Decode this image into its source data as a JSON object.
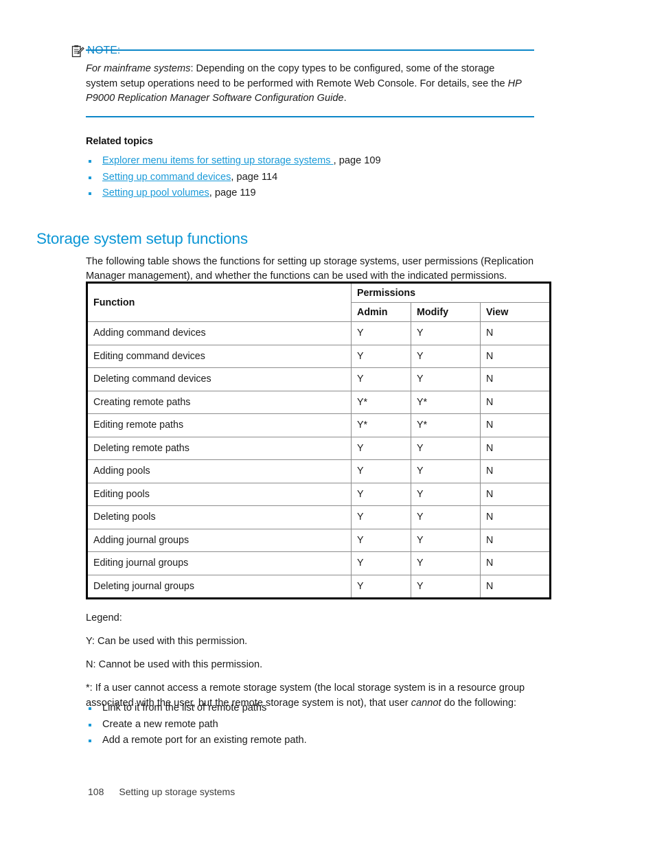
{
  "note": {
    "icon": "note-clipboard-icon",
    "label": "NOTE:",
    "body_italic_lead": "For mainframe systems",
    "body_part1": ": Depending on the copy types to be configured, some of the storage system setup operations need to be performed with Remote Web Console. For details, see the ",
    "body_italic_title": "HP P9000 Replication Manager Software Configuration Guide",
    "body_end": ".",
    "rule_color": "#0b86c8"
  },
  "related": {
    "title": "Related topics",
    "items": [
      {
        "link": "Explorer menu items for setting up storage systems ",
        "suffix": ", page 109"
      },
      {
        "link": "Setting up command devices",
        "suffix": ", page 114"
      },
      {
        "link": "Setting up pool volumes",
        "suffix": ", page 119"
      }
    ]
  },
  "section": {
    "heading": "Storage system setup functions",
    "heading_color": "#0b96d5",
    "intro": "The following table shows the functions for setting up storage systems, user permissions (Replication Manager management), and whether the functions can be used with the indicated permissions."
  },
  "table": {
    "function_header": "Function",
    "permissions_header": "Permissions",
    "sub_headers": [
      "Admin",
      "Modify",
      "View"
    ],
    "rows": [
      {
        "function": "Adding command devices",
        "admin": "Y",
        "modify": "Y",
        "view": "N"
      },
      {
        "function": "Editing command devices",
        "admin": "Y",
        "modify": "Y",
        "view": "N"
      },
      {
        "function": "Deleting command devices",
        "admin": "Y",
        "modify": "Y",
        "view": "N"
      },
      {
        "function": "Creating remote paths",
        "admin": "Y*",
        "modify": "Y*",
        "view": "N"
      },
      {
        "function": "Editing remote paths",
        "admin": "Y*",
        "modify": "Y*",
        "view": "N"
      },
      {
        "function": "Deleting remote paths",
        "admin": "Y",
        "modify": "Y",
        "view": "N"
      },
      {
        "function": "Adding pools",
        "admin": "Y",
        "modify": "Y",
        "view": "N"
      },
      {
        "function": "Editing pools",
        "admin": "Y",
        "modify": "Y",
        "view": "N"
      },
      {
        "function": "Deleting pools",
        "admin": "Y",
        "modify": "Y",
        "view": "N"
      },
      {
        "function": "Adding journal groups",
        "admin": "Y",
        "modify": "Y",
        "view": "N"
      },
      {
        "function": "Editing journal groups",
        "admin": "Y",
        "modify": "Y",
        "view": "N"
      },
      {
        "function": "Deleting journal groups",
        "admin": "Y",
        "modify": "Y",
        "view": "N"
      }
    ]
  },
  "legend": {
    "title": "Legend:",
    "y_line": "Y: Can be used with this permission.",
    "n_line": "N: Cannot be used with this permission.",
    "star_part1": "*: If a user cannot access a remote storage system (the local storage system is in a resource group associated with the user, but the remote storage system is not), that user ",
    "star_italic": "cannot",
    "star_part2": " do the following:",
    "items": [
      "Link to it from the list of remote paths",
      "Create a new remote path",
      "Add a remote port for an existing remote path."
    ]
  },
  "footer": {
    "page_number": "108",
    "chapter": "Setting up storage systems"
  }
}
